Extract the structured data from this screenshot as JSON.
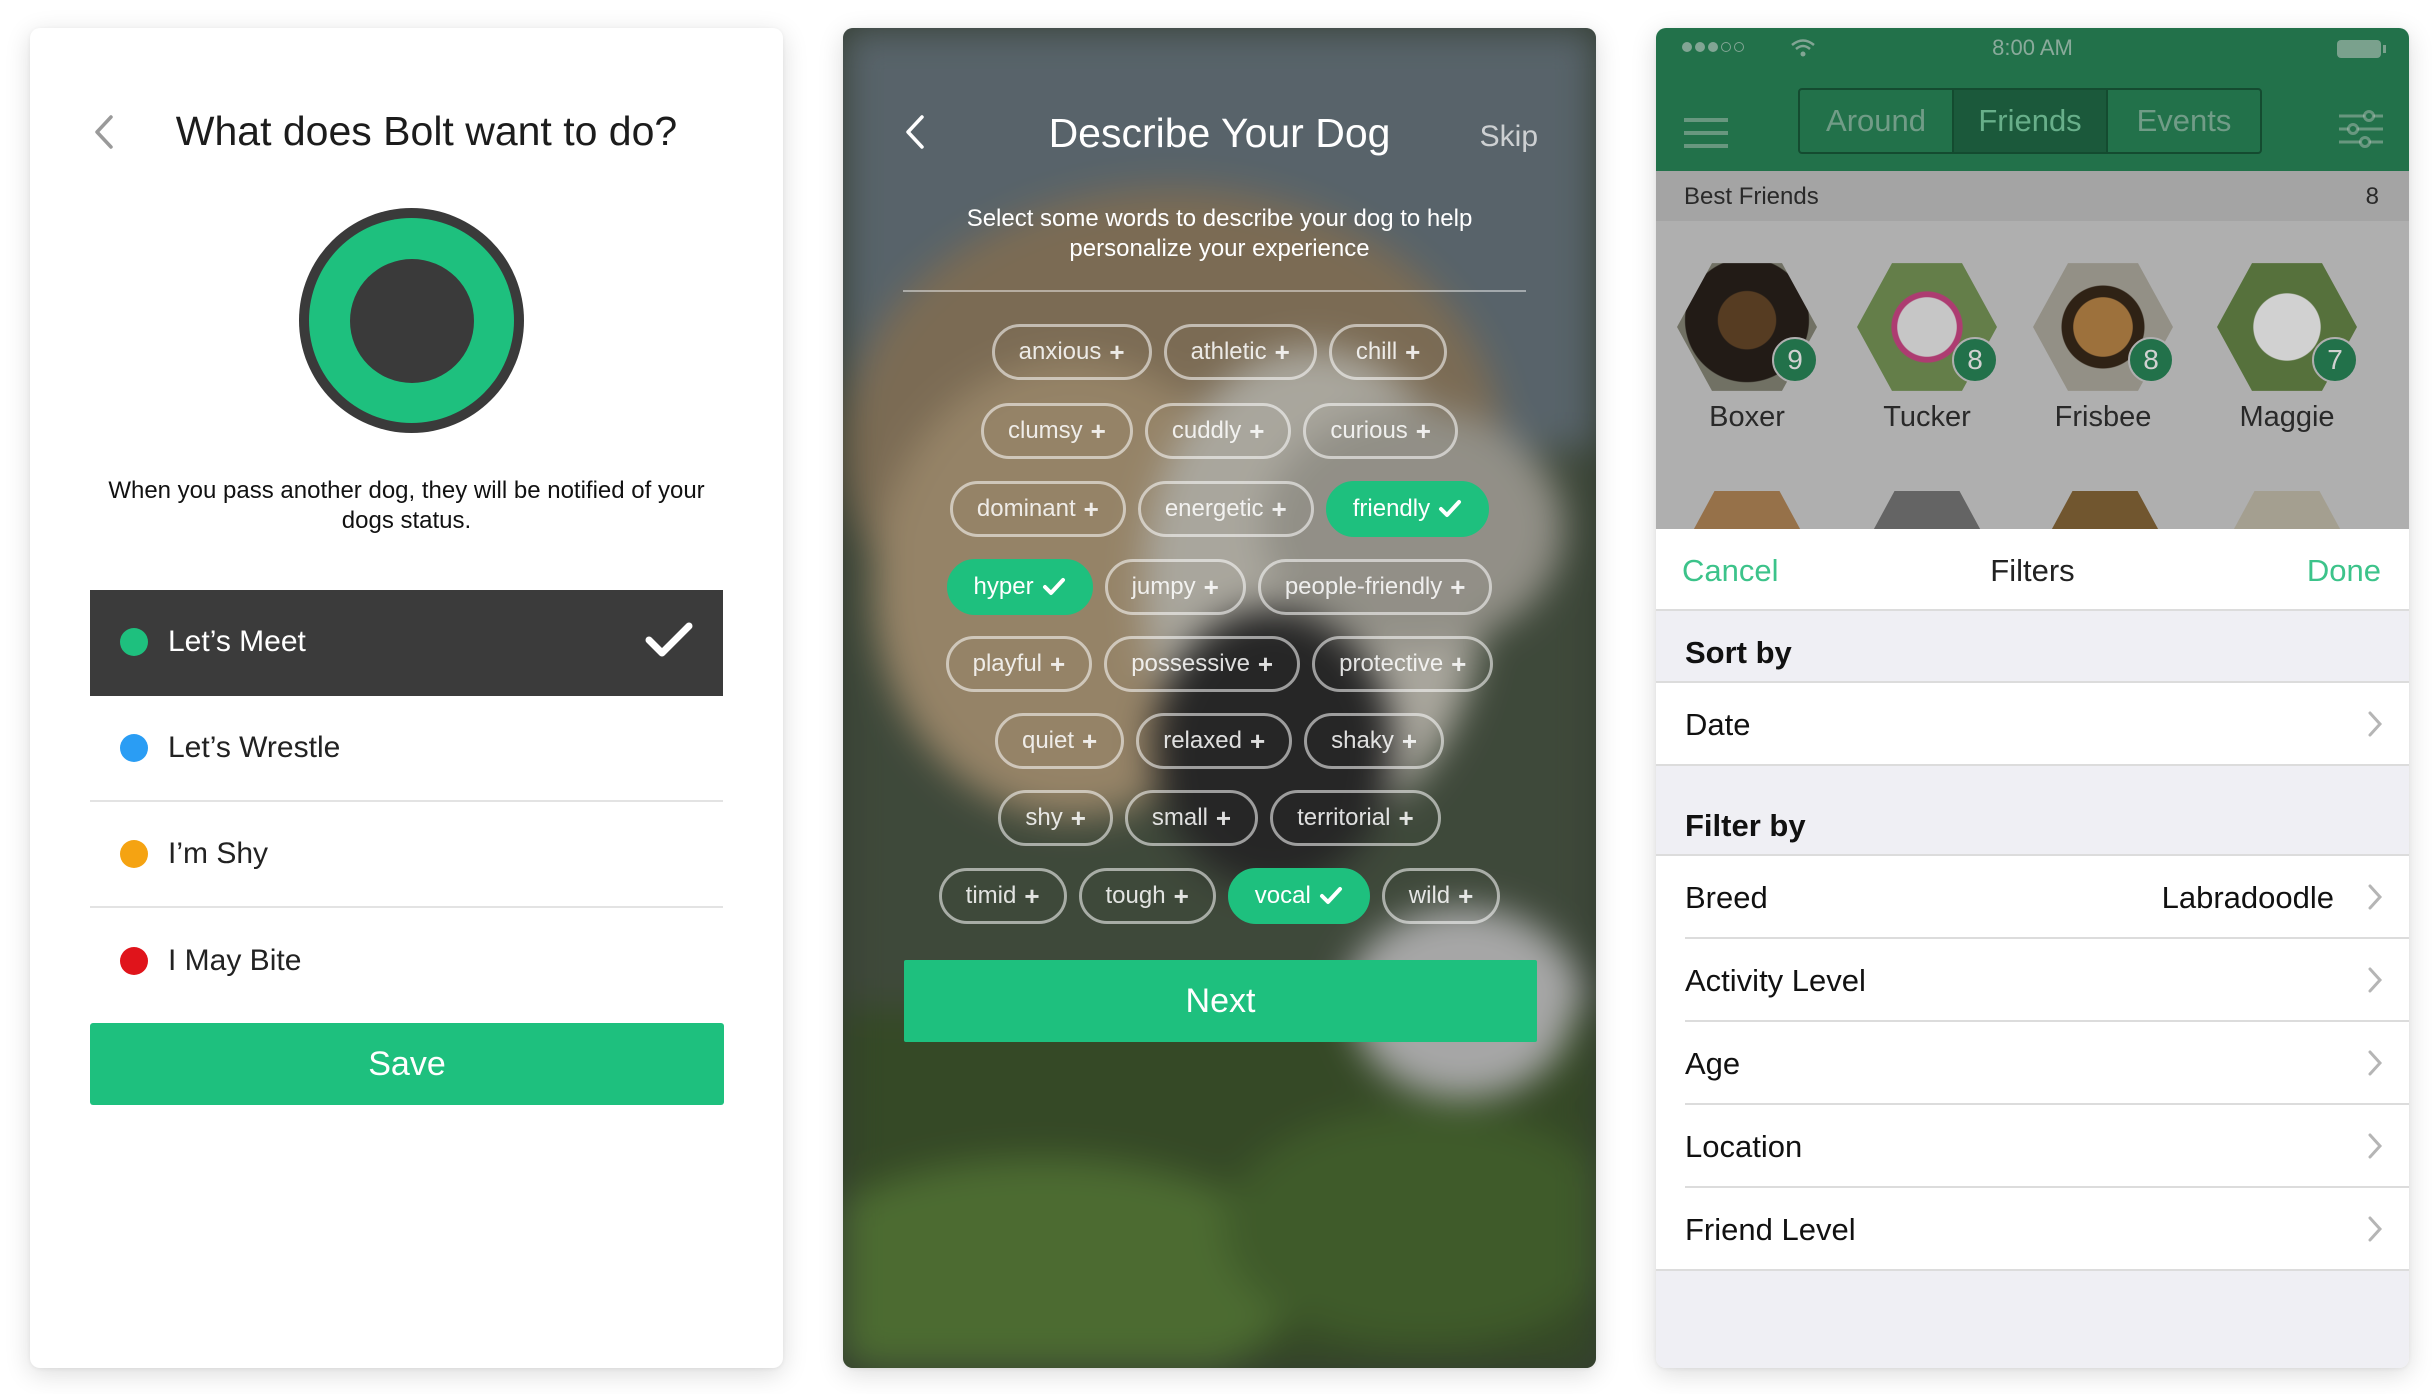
{
  "panel1": {
    "title": "What does Bolt want to do?",
    "description": "When you pass another dog, they will be notified of your dogs status.",
    "options": [
      {
        "label": "Let’s Meet",
        "color": "#1ec07e",
        "selected": true
      },
      {
        "label": "Let’s Wrestle",
        "color": "#2a9df4",
        "selected": false
      },
      {
        "label": "I’m Shy",
        "color": "#f5a312",
        "selected": false
      },
      {
        "label": "I May Bite",
        "color": "#e0141b",
        "selected": false
      }
    ],
    "save_label": "Save"
  },
  "panel2": {
    "title": "Describe Your Dog",
    "skip_label": "Skip",
    "subtitle": "Select some words to describe your dog to help personalize your experience",
    "tag_rows": [
      [
        {
          "label": "anxious",
          "on": false
        },
        {
          "label": "athletic",
          "on": false
        },
        {
          "label": "chill",
          "on": false
        }
      ],
      [
        {
          "label": "clumsy",
          "on": false
        },
        {
          "label": "cuddly",
          "on": false
        },
        {
          "label": "curious",
          "on": false
        }
      ],
      [
        {
          "label": "dominant",
          "on": false
        },
        {
          "label": "energetic",
          "on": false
        },
        {
          "label": "friendly",
          "on": true
        }
      ],
      [
        {
          "label": "hyper",
          "on": true
        },
        {
          "label": "jumpy",
          "on": false
        },
        {
          "label": "people-friendly",
          "on": false
        }
      ],
      [
        {
          "label": "playful",
          "on": false
        },
        {
          "label": "possessive",
          "on": false
        },
        {
          "label": "protective",
          "on": false
        }
      ],
      [
        {
          "label": "quiet",
          "on": false
        },
        {
          "label": "relaxed",
          "on": false
        },
        {
          "label": "shaky",
          "on": false
        }
      ],
      [
        {
          "label": "shy",
          "on": false
        },
        {
          "label": "small",
          "on": false
        },
        {
          "label": "territorial",
          "on": false
        }
      ],
      [
        {
          "label": "timid",
          "on": false
        },
        {
          "label": "tough",
          "on": false
        },
        {
          "label": "vocal",
          "on": true
        },
        {
          "label": "wild",
          "on": false
        }
      ]
    ],
    "next_label": "Next"
  },
  "panel3": {
    "status_time": "8:00 AM",
    "tabs": [
      "Around",
      "Friends",
      "Events"
    ],
    "active_tab": "Friends",
    "best_friends_label": "Best Friends",
    "best_friends_count": "8",
    "friends": [
      {
        "name": "Boxer",
        "score": "9"
      },
      {
        "name": "Tucker",
        "score": "8"
      },
      {
        "name": "Frisbee",
        "score": "8"
      },
      {
        "name": "Maggie",
        "score": "7"
      }
    ],
    "sheet": {
      "cancel": "Cancel",
      "title": "Filters",
      "done": "Done",
      "sort_header": "Sort by",
      "sort_rows": [
        {
          "label": "Date",
          "value": ""
        }
      ],
      "filter_header": "Filter by",
      "filter_rows": [
        {
          "label": "Breed",
          "value": "Labradoodle"
        },
        {
          "label": "Activity Level",
          "value": ""
        },
        {
          "label": "Age",
          "value": ""
        },
        {
          "label": "Location",
          "value": ""
        },
        {
          "label": "Friend Level",
          "value": ""
        }
      ]
    }
  },
  "colors": {
    "accent": "#1ec07e",
    "dark": "#3b3b3b",
    "nav_green": "#2a8a5b",
    "link_green": "#3cc38a"
  },
  "icons": [
    "chevron-left-icon",
    "checkmark-icon",
    "plus-icon",
    "hamburger-menu-icon",
    "sliders-filter-icon",
    "chevron-right-icon",
    "wifi-icon",
    "battery-icon"
  ]
}
